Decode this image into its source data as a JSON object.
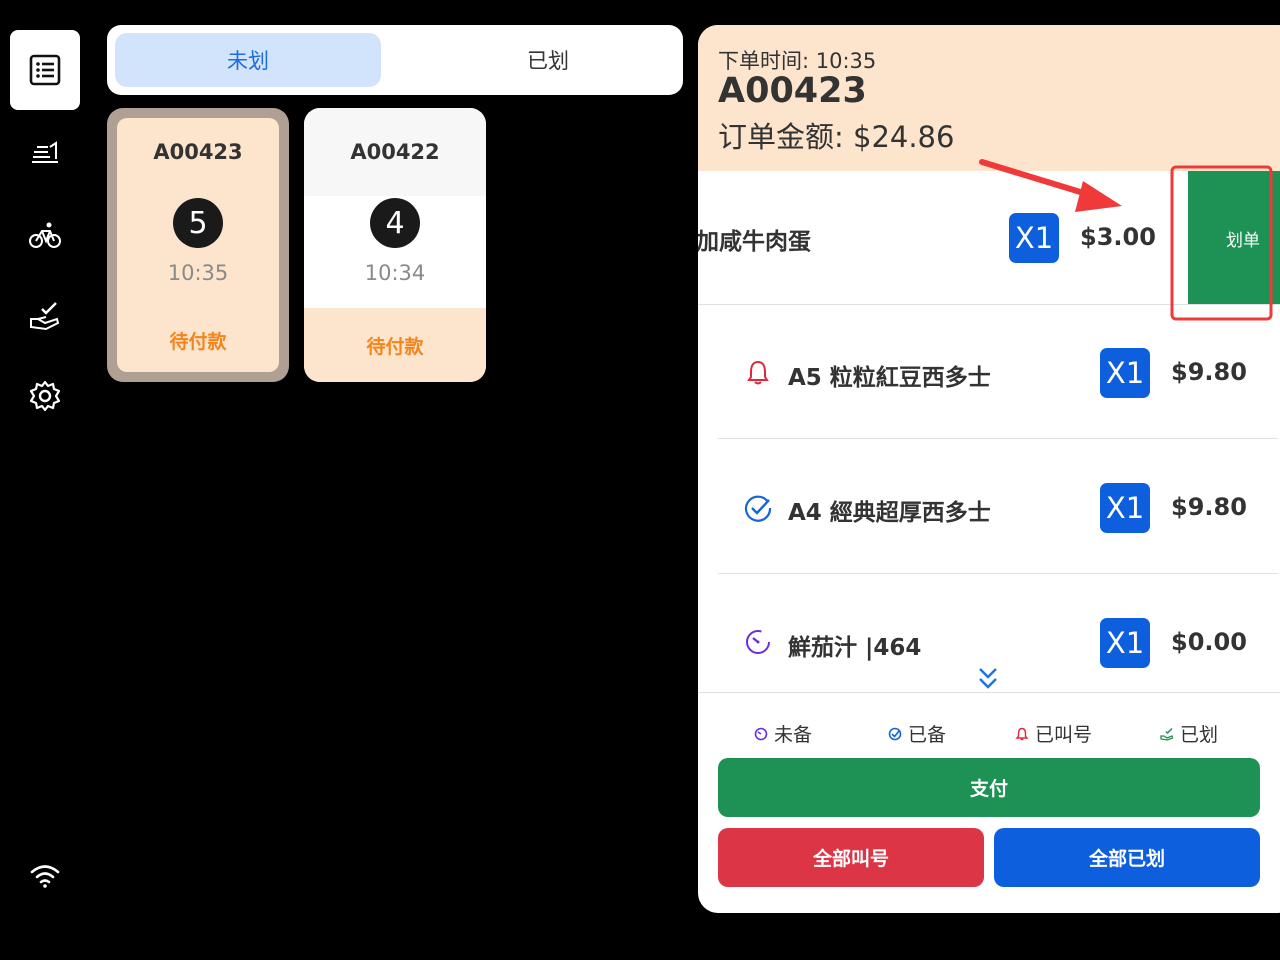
{
  "sidebar": {
    "items": [
      {
        "icon": "order-list-icon"
      },
      {
        "icon": "serving-tray-icon"
      },
      {
        "icon": "bicycle-delivery-icon"
      },
      {
        "icon": "hand-check-icon"
      },
      {
        "icon": "gear-icon"
      }
    ],
    "status_icon": "wifi-icon"
  },
  "tabs": [
    {
      "label": "未划",
      "active": true
    },
    {
      "label": "已划",
      "active": false
    }
  ],
  "orders": [
    {
      "id": "A00423",
      "count": "5",
      "time": "10:35",
      "status": "待付款",
      "selected": true
    },
    {
      "id": "A00422",
      "count": "4",
      "time": "10:34",
      "status": "待付款",
      "selected": false
    }
  ],
  "detail": {
    "order_time": "下单时间: 10:35",
    "order_id": "A00423",
    "amount": "订单金额: $24.86",
    "items": [
      {
        "name": "加咸牛肉蛋",
        "qty": "X1",
        "price": "$3.00",
        "status_icon": "none"
      },
      {
        "name": "A5 粒粒紅豆西多士",
        "qty": "X1",
        "price": "$9.80",
        "status_icon": "bell-icon"
      },
      {
        "name": "A4 經典超厚西多士",
        "qty": "X1",
        "price": "$9.80",
        "status_icon": "check-circle-icon"
      },
      {
        "name": "鮮茄汁 |464",
        "qty": "X1",
        "price": "$0.00",
        "status_icon": "timer-icon"
      }
    ],
    "swipe_action": "划单",
    "scroll_icon": "double-chevron-down-icon",
    "legend": [
      {
        "label": "未备",
        "icon": "timer-icon",
        "color": "#6a2de0"
      },
      {
        "label": "已备",
        "icon": "check-circle-icon",
        "color": "#1565d8"
      },
      {
        "label": "已叫号",
        "icon": "bell-icon",
        "color": "#e0283b"
      },
      {
        "label": "已划",
        "icon": "hand-check-icon",
        "color": "#1e9155"
      }
    ],
    "buttons": {
      "pay": "支付",
      "call_all": "全部叫号",
      "mark_all": "全部已划"
    }
  },
  "colors": {
    "accent_blue": "#0d5fde",
    "pay_green": "#1e9155",
    "call_red": "#dc3545",
    "order_highlight": "#fde4cd",
    "pending_orange": "#f2851c",
    "annotation_red": "#f03a3a"
  }
}
